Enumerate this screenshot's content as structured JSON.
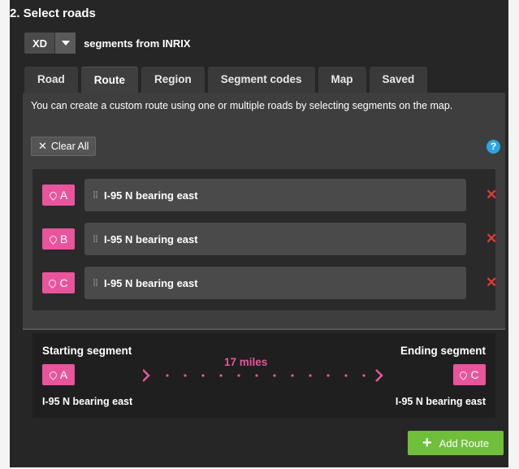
{
  "section_title": "2. Select roads",
  "segment_type": {
    "selected": "XD",
    "suffix": "segments from  INRIX"
  },
  "tabs": [
    {
      "label": "Road",
      "active": false
    },
    {
      "label": "Route",
      "active": true
    },
    {
      "label": "Region",
      "active": false
    },
    {
      "label": "Segment codes",
      "active": false
    },
    {
      "label": "Map",
      "active": false
    },
    {
      "label": "Saved",
      "active": false
    }
  ],
  "route": {
    "description": "You can create a custom route using one or multiple roads by selecting segments on the map.",
    "clear_all_label": "Clear All",
    "help_label": "?",
    "roads": [
      {
        "marker": "A",
        "name": "I-95 N bearing east"
      },
      {
        "marker": "B",
        "name": "I-95 N bearing east"
      },
      {
        "marker": "C",
        "name": "I-95 N bearing east"
      }
    ]
  },
  "summary": {
    "start_label": "Starting segment",
    "end_label": "Ending segment",
    "start_marker": "A",
    "end_marker": "C",
    "start_road": "I-95 N bearing east",
    "end_road": "I-95 N bearing east",
    "distance": "17 miles"
  },
  "add_route_label": "Add Route",
  "colors": {
    "accent_pink": "#e8559c",
    "add_green": "#6fbf3a",
    "remove_red": "#e53935",
    "help_blue": "#2aa6e0"
  },
  "icons": {
    "marker": "map-pin-icon",
    "remove": "close-icon",
    "drag": "drag-handle-icon",
    "add": "plus-icon"
  }
}
